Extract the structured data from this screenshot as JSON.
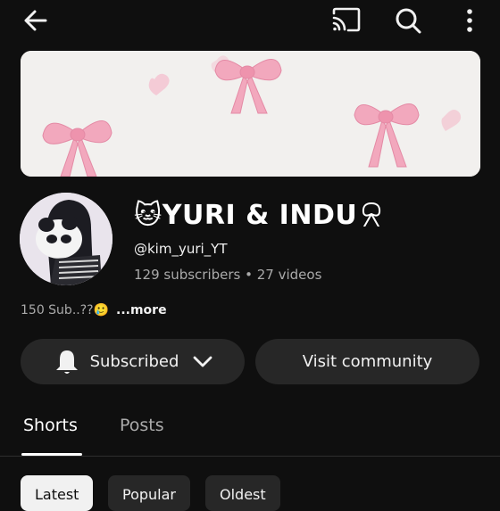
{
  "channel": {
    "name": "YURI & INDU",
    "handle": "@kim_yuri_YT",
    "stats": "129 subscribers • 27 videos",
    "description": "150 Sub..??🥲",
    "more": "...more"
  },
  "icons": {
    "back": "arrow-left-icon",
    "cast": "cast-icon",
    "search": "search-icon",
    "menu": "more-vertical-icon",
    "bell": "bell-icon",
    "chevron": "chevron-down-icon"
  },
  "actions": {
    "subscribed_label": "Subscribed",
    "community_label": "Visit community"
  },
  "tabs": [
    {
      "label": "Shorts",
      "active": true
    },
    {
      "label": "Posts",
      "active": false
    }
  ],
  "sort_chips": [
    {
      "label": "Latest",
      "active": true
    },
    {
      "label": "Popular",
      "active": false
    },
    {
      "label": "Oldest",
      "active": false
    }
  ],
  "colors": {
    "background": "#0f0f0f",
    "surface": "#272727",
    "text": "#f1f1f1",
    "muted": "#aaaaaa",
    "bow_pink": "#f2a8bd"
  }
}
